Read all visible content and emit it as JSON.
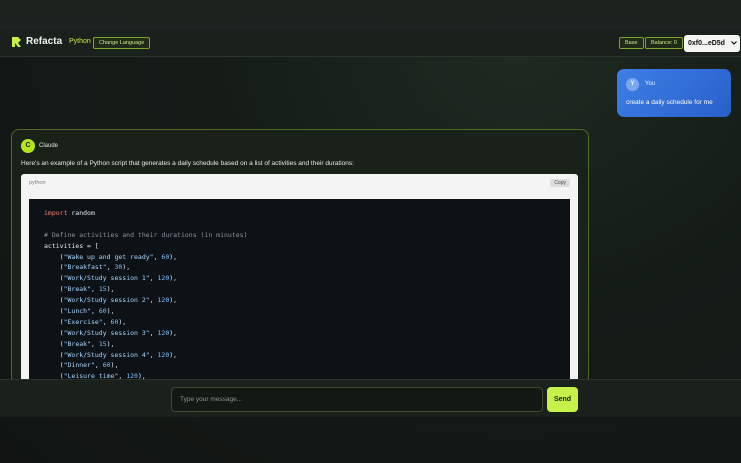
{
  "header": {
    "brand": "Refacta",
    "language": "Python",
    "change_language_label": "Change Language",
    "network_label": "Base",
    "balance_label": "Balance: 0",
    "wallet_address": "0xf0...eD5d",
    "accent_color": "#c6f04a"
  },
  "chat": {
    "user_message": {
      "avatar_initial": "Y",
      "author": "You",
      "text": "create a daily schedule for me"
    },
    "ai_message": {
      "avatar_initial": "C",
      "author": "Claude",
      "intro": "Here's an example of a Python script that generates a daily schedule based on a list of activities and their durations:",
      "code_block": {
        "language": "python",
        "copy_label": "Copy",
        "lines": [
          [
            {
              "t": "kw",
              "v": "import"
            },
            {
              "t": "pl",
              "v": " random"
            }
          ],
          [],
          [
            {
              "t": "cm",
              "v": "# Define activities and their durations (in minutes)"
            }
          ],
          [
            {
              "t": "pl",
              "v": "activities = ["
            }
          ],
          [
            {
              "t": "pl",
              "v": "    ("
            },
            {
              "t": "st",
              "v": "\"Wake up and get ready\""
            },
            {
              "t": "pl",
              "v": ", "
            },
            {
              "t": "nm",
              "v": "60"
            },
            {
              "t": "pl",
              "v": "),"
            }
          ],
          [
            {
              "t": "pl",
              "v": "    ("
            },
            {
              "t": "st",
              "v": "\"Breakfast\""
            },
            {
              "t": "pl",
              "v": ", "
            },
            {
              "t": "nm",
              "v": "30"
            },
            {
              "t": "pl",
              "v": "),"
            }
          ],
          [
            {
              "t": "pl",
              "v": "    ("
            },
            {
              "t": "st",
              "v": "\"Work/Study session 1\""
            },
            {
              "t": "pl",
              "v": ", "
            },
            {
              "t": "nm",
              "v": "120"
            },
            {
              "t": "pl",
              "v": "),"
            }
          ],
          [
            {
              "t": "pl",
              "v": "    ("
            },
            {
              "t": "st",
              "v": "\"Break\""
            },
            {
              "t": "pl",
              "v": ", "
            },
            {
              "t": "nm",
              "v": "15"
            },
            {
              "t": "pl",
              "v": "),"
            }
          ],
          [
            {
              "t": "pl",
              "v": "    ("
            },
            {
              "t": "st",
              "v": "\"Work/Study session 2\""
            },
            {
              "t": "pl",
              "v": ", "
            },
            {
              "t": "nm",
              "v": "120"
            },
            {
              "t": "pl",
              "v": "),"
            }
          ],
          [
            {
              "t": "pl",
              "v": "    ("
            },
            {
              "t": "st",
              "v": "\"Lunch\""
            },
            {
              "t": "pl",
              "v": ", "
            },
            {
              "t": "nm",
              "v": "60"
            },
            {
              "t": "pl",
              "v": "),"
            }
          ],
          [
            {
              "t": "pl",
              "v": "    ("
            },
            {
              "t": "st",
              "v": "\"Exercise\""
            },
            {
              "t": "pl",
              "v": ", "
            },
            {
              "t": "nm",
              "v": "60"
            },
            {
              "t": "pl",
              "v": "),"
            }
          ],
          [
            {
              "t": "pl",
              "v": "    ("
            },
            {
              "t": "st",
              "v": "\"Work/Study session 3\""
            },
            {
              "t": "pl",
              "v": ", "
            },
            {
              "t": "nm",
              "v": "120"
            },
            {
              "t": "pl",
              "v": "),"
            }
          ],
          [
            {
              "t": "pl",
              "v": "    ("
            },
            {
              "t": "st",
              "v": "\"Break\""
            },
            {
              "t": "pl",
              "v": ", "
            },
            {
              "t": "nm",
              "v": "15"
            },
            {
              "t": "pl",
              "v": "),"
            }
          ],
          [
            {
              "t": "pl",
              "v": "    ("
            },
            {
              "t": "st",
              "v": "\"Work/Study session 4\""
            },
            {
              "t": "pl",
              "v": ", "
            },
            {
              "t": "nm",
              "v": "120"
            },
            {
              "t": "pl",
              "v": "),"
            }
          ],
          [
            {
              "t": "pl",
              "v": "    ("
            },
            {
              "t": "st",
              "v": "\"Dinner\""
            },
            {
              "t": "pl",
              "v": ", "
            },
            {
              "t": "nm",
              "v": "60"
            },
            {
              "t": "pl",
              "v": "),"
            }
          ],
          [
            {
              "t": "pl",
              "v": "    ("
            },
            {
              "t": "st",
              "v": "\"Leisure time\""
            },
            {
              "t": "pl",
              "v": ", "
            },
            {
              "t": "nm",
              "v": "120"
            },
            {
              "t": "pl",
              "v": "),"
            }
          ]
        ]
      }
    }
  },
  "composer": {
    "placeholder": "Type your message...",
    "value": "",
    "send_label": "Send"
  }
}
